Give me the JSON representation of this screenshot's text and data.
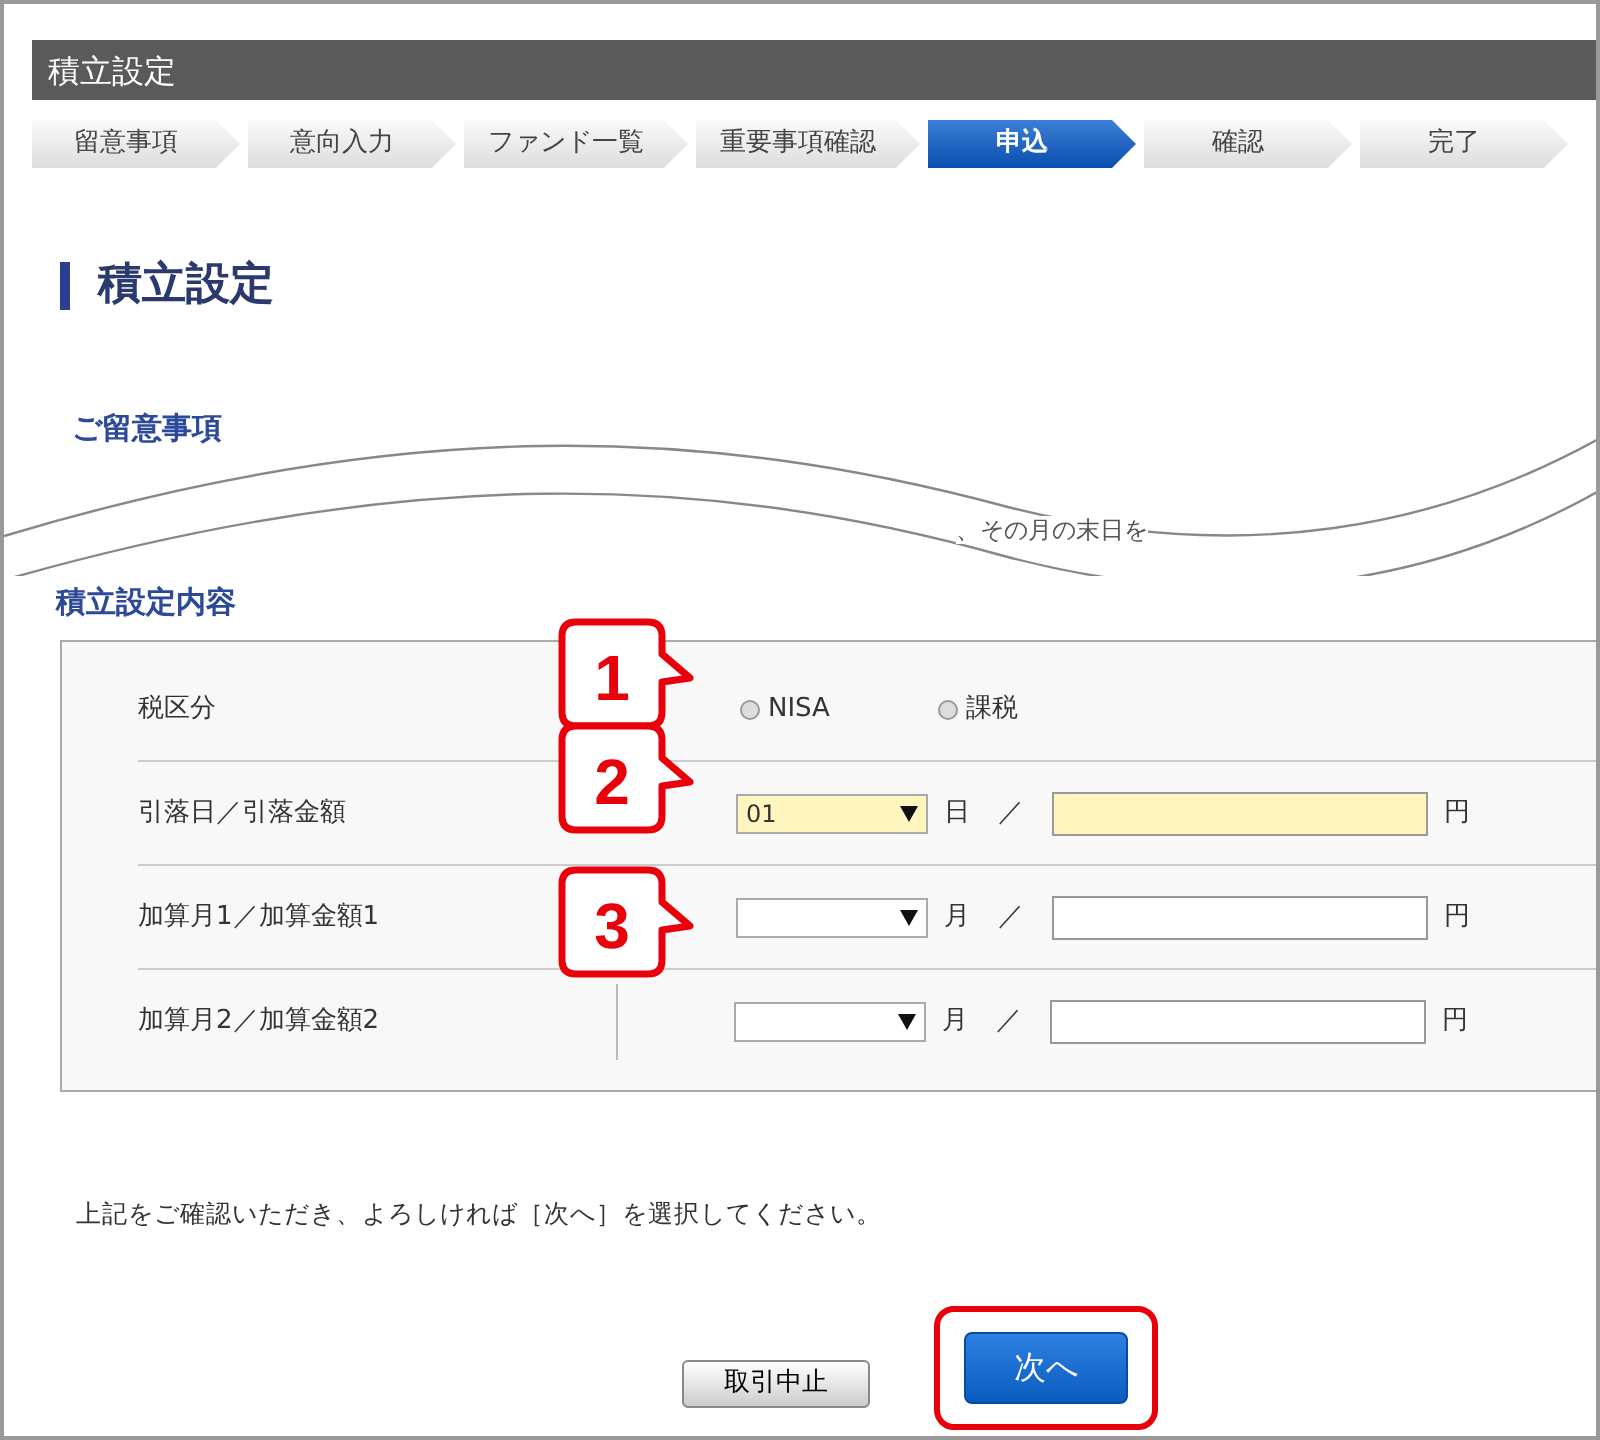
{
  "window": {
    "title": "積立設定"
  },
  "steps": [
    {
      "label": "留意事項",
      "selected": false
    },
    {
      "label": "意向入力",
      "selected": false
    },
    {
      "label": "ファンド一覧",
      "selected": false
    },
    {
      "label": "重要事項確認",
      "selected": false
    },
    {
      "label": "申込",
      "selected": true
    },
    {
      "label": "確認",
      "selected": false
    },
    {
      "label": "完了",
      "selected": false
    }
  ],
  "page_heading": "積立設定",
  "notice": {
    "heading": "ご留意事項",
    "fragment": "、その月の末日を"
  },
  "form": {
    "heading": "積立設定内容",
    "rows": [
      {
        "kind": "radio",
        "label": "税区分",
        "callout": "1",
        "options": [
          {
            "label": "NISA",
            "selected": false
          },
          {
            "label": "課税",
            "selected": false
          }
        ]
      },
      {
        "kind": "amount",
        "label": "引落日／引落金額",
        "callout": "2",
        "select": "01",
        "unit": "日",
        "separator": "／",
        "currency": "円",
        "highlighted": true
      },
      {
        "kind": "amount",
        "label": "加算月1／加算金額1",
        "callout": "3",
        "unit": "月",
        "separator": "／",
        "currency": "円",
        "highlighted": false
      },
      {
        "kind": "amount",
        "label": "加算月2／加算金額2",
        "unit": "月",
        "separator": "／",
        "currency": "円",
        "highlighted": false
      }
    ]
  },
  "instruction": "上記をご確認いただき、よろしければ［次へ］を選択してください。",
  "buttons": [
    {
      "label": "取引中止",
      "kind": "secondary",
      "highlighted": false
    },
    {
      "label": "次へ",
      "kind": "primary",
      "highlighted": true
    }
  ]
}
